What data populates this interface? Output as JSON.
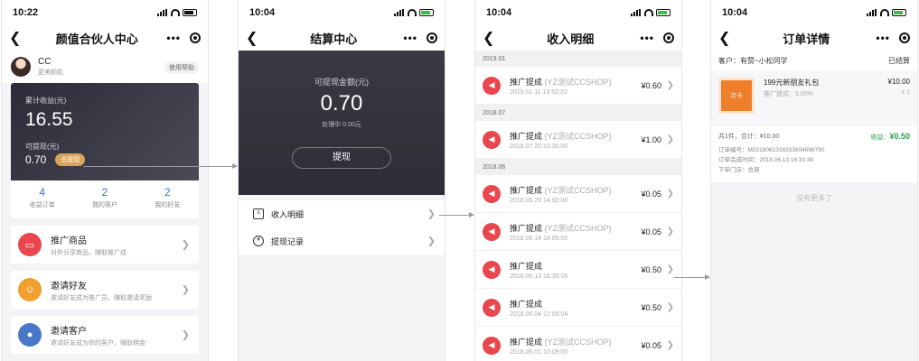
{
  "screen1": {
    "time": "10:22",
    "title": "颜值合伙人中心",
    "user": {
      "name": "CC",
      "subtitle": "更美颜肌",
      "help": "使用帮助"
    },
    "card": {
      "total_label": "累计收益(元)",
      "total_value": "16.55",
      "withdraw_label": "可提现(元)",
      "withdraw_value": "0.70",
      "withdraw_btn": "去提现"
    },
    "stats": [
      {
        "value": "4",
        "label": "收益订单"
      },
      {
        "value": "2",
        "label": "我的客户"
      },
      {
        "value": "2",
        "label": "我的好友"
      }
    ],
    "menu": [
      {
        "title": "推广商品",
        "subtitle": "对外分享商品，赚取推广成",
        "color": "#e9464e",
        "icon": "wallet-icon"
      },
      {
        "title": "邀请好友",
        "subtitle": "邀请好友成为推广员，赚取邀请奖励",
        "color": "#f0a031",
        "icon": "friends-icon"
      },
      {
        "title": "邀请客户",
        "subtitle": "邀请好友成为你的客户，赚取佣金",
        "color": "#4a78c9",
        "icon": "user-icon"
      }
    ]
  },
  "screen2": {
    "time": "10:04",
    "title": "结算中心",
    "card": {
      "label": "可提现金额(元)",
      "value": "0.70",
      "pending": "处理中 0.00元",
      "button": "提现"
    },
    "items": [
      "收入明细",
      "提现记录"
    ]
  },
  "screen3": {
    "time": "10:04",
    "title": "收入明细",
    "groups": [
      {
        "month": "2019.01",
        "rows": [
          {
            "title": "推广提成",
            "shop": "(YZ测试CCSHOP)",
            "time": "2019.01.11 13:52:20",
            "amount": "¥0.60"
          }
        ]
      },
      {
        "month": "2018.07",
        "rows": [
          {
            "title": "推广提成",
            "shop": "(YZ测试CCSHOP)",
            "time": "2018.07.20 10:30:00",
            "amount": "¥1.00"
          }
        ]
      },
      {
        "month": "2018.06",
        "rows": [
          {
            "title": "推广提成",
            "shop": "(YZ测试CCSHOP)",
            "time": "2018.06.29 14:00:00",
            "amount": "¥0.05"
          },
          {
            "title": "推广提成",
            "shop": "(YZ测试CCSHOP)",
            "time": "2018.06.14 14:05:00",
            "amount": "¥0.05"
          },
          {
            "title": "推广提成",
            "shop": "",
            "time": "2018.06.13 16:35:05",
            "amount": "¥0.50"
          },
          {
            "title": "推广提成",
            "shop": "",
            "time": "2018.06.04 12:05:04",
            "amount": "¥0.50"
          },
          {
            "title": "推广提成",
            "shop": "(YZ测试CCSHOP)",
            "time": "2018.06.01 10:09:00",
            "amount": "¥0.05"
          }
        ]
      }
    ]
  },
  "screen4": {
    "time": "10:04",
    "title": "订单详情",
    "customer": "客户：有赞~小松同学",
    "status": "已结算",
    "item": {
      "image_label": "次卡",
      "title": "199元新朋友礼包",
      "subtitle": "推广提成：5.00%",
      "price": "¥10.00",
      "qty": "x 1"
    },
    "summary": {
      "total": "共1件，合计：¥10.00",
      "earn_label": "收益：",
      "earn_value": "¥0.50"
    },
    "details": [
      "订单编号：M2018061316333694696790",
      "订单完成时间：2018.06.13 16:33:39",
      "下单门店：总部"
    ],
    "no_more": "没有更多了"
  }
}
